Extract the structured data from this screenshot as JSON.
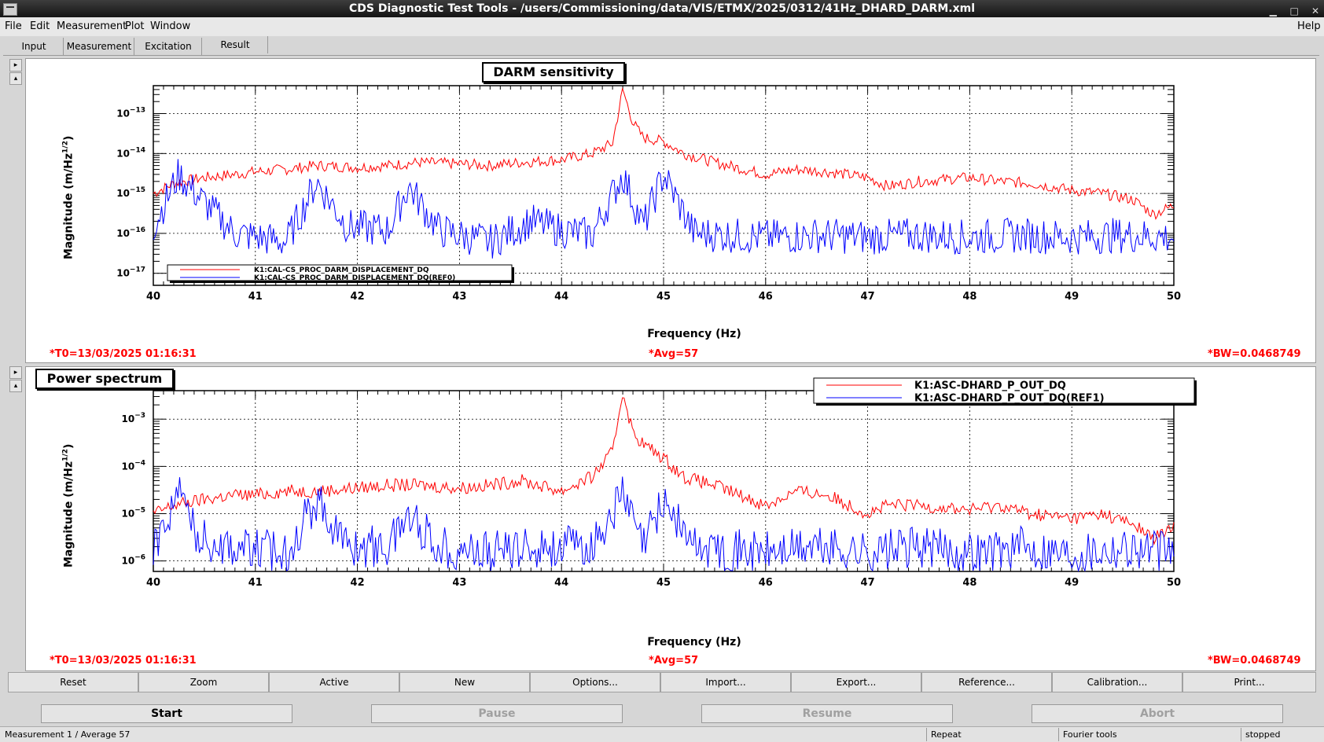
{
  "window": {
    "title": "CDS Diagnostic Test Tools - /users/Commissioning/data/VIS/ETMX/2025/0312/41Hz_DHARD_DARM.xml"
  },
  "menu": [
    "File",
    "Edit",
    "Measurement",
    "Plot",
    "Window"
  ],
  "menu_right": "Help",
  "tabs": [
    "Input",
    "Measurement",
    "Excitation",
    "Result"
  ],
  "active_tab": "Result",
  "plots": [
    {
      "title": "DARM sensitivity",
      "ylabel": "Magnitude (m/Hz",
      "ylabel_sup": "1/2",
      "ylabel_end": ")",
      "xlabel": "Frequency (Hz)",
      "t0": "*T0=13/03/2025 01:16:31",
      "avg": "*Avg=57",
      "bw": "*BW=0.0468749",
      "legend": [
        "K1:CAL-CS_PROC_DARM_DISPLACEMENT_DQ",
        "K1:CAL-CS_PROC_DARM_DISPLACEMENT_DQ(REF0)"
      ]
    },
    {
      "title": "Power spectrum",
      "ylabel": "Magnitude (m/Hz",
      "ylabel_sup": "1/2",
      "ylabel_end": ")",
      "xlabel": "Frequency (Hz)",
      "t0": "*T0=13/03/2025 01:16:31",
      "avg": "*Avg=57",
      "bw": "*BW=0.0468749",
      "legend": [
        "K1:ASC-DHARD_P_OUT_DQ",
        "K1:ASC-DHARD_P_OUT_DQ(REF1)"
      ]
    }
  ],
  "chart_data": [
    {
      "type": "line",
      "title": "DARM sensitivity",
      "xlabel": "Frequency (Hz)",
      "ylabel": "Magnitude (m/Hz^1/2)",
      "xlim": [
        40,
        50
      ],
      "xticks": [
        40,
        41,
        42,
        43,
        44,
        45,
        46,
        47,
        48,
        49,
        50
      ],
      "ylim": [
        5e-18,
        5e-13
      ],
      "yscale": "log",
      "yticks": [
        {
          "v": 1e-13,
          "b": "10",
          "e": "−13"
        },
        {
          "v": 1e-14,
          "b": "10",
          "e": "−14"
        },
        {
          "v": 1e-15,
          "b": "10",
          "e": "−15"
        },
        {
          "v": 1e-16,
          "b": "10",
          "e": "−16"
        },
        {
          "v": 1e-17,
          "b": "10",
          "e": "−17"
        }
      ],
      "grid": true,
      "legend_position": "bottom-left",
      "series": [
        {
          "name": "K1:CAL-CS_PROC_DARM_DISPLACEMENT_DQ",
          "color": "#ff0000",
          "x": [
            40,
            40.2,
            40.5,
            40.8,
            41,
            41.3,
            41.6,
            42,
            42.3,
            42.6,
            43,
            43.3,
            43.6,
            44,
            44.3,
            44.5,
            44.6,
            44.7,
            44.8,
            45,
            45.2,
            45.5,
            46,
            46.3,
            46.6,
            47,
            47.2,
            47.5,
            48,
            48.3,
            48.6,
            49,
            49.3,
            49.6,
            49.8,
            50
          ],
          "y": [
            1e-15,
            1.8e-15,
            2.5e-15,
            3e-15,
            3.5e-15,
            4e-15,
            5e-15,
            4.5e-15,
            5e-15,
            6e-15,
            5.5e-15,
            5e-15,
            6e-15,
            7e-15,
            1e-14,
            1.8e-14,
            4e-13,
            6e-14,
            2.5e-14,
            2e-14,
            1e-14,
            6e-15,
            3e-15,
            4e-15,
            3.5e-15,
            2.5e-15,
            1.5e-15,
            2e-15,
            2.5e-15,
            2e-15,
            1.8e-15,
            1.2e-15,
            1e-15,
            7e-16,
            3e-16,
            5e-16
          ]
        },
        {
          "name": "K1:CAL-CS_PROC_DARM_DISPLACEMENT_DQ(REF0)",
          "color": "#0000ff",
          "x": [
            40,
            40.25,
            40.45,
            40.8,
            41.3,
            41.6,
            41.9,
            42.3,
            42.5,
            42.8,
            43.3,
            43.7,
            44,
            44.3,
            44.6,
            44.8,
            45,
            45.3,
            46,
            46.5,
            47,
            47.5,
            48,
            48.5,
            49,
            49.5,
            50
          ],
          "y": [
            1.5e-16,
            3e-15,
            8e-16,
            1e-16,
            6e-17,
            2e-15,
            1.5e-16,
            1.2e-16,
            1.5e-15,
            1.2e-16,
            6e-17,
            2e-16,
            1.2e-16,
            9e-17,
            3e-15,
            1.5e-16,
            3e-15,
            1e-16,
            8e-17,
            9e-17,
            8e-17,
            9e-17,
            8e-17,
            9e-17,
            8e-17,
            9e-17,
            8e-17
          ]
        }
      ]
    },
    {
      "type": "line",
      "title": "Power spectrum",
      "xlabel": "Frequency (Hz)",
      "ylabel": "Magnitude (m/Hz^1/2)",
      "xlim": [
        40,
        50
      ],
      "xticks": [
        40,
        41,
        42,
        43,
        44,
        45,
        46,
        47,
        48,
        49,
        50
      ],
      "ylim": [
        6e-07,
        0.004
      ],
      "yscale": "log",
      "yticks": [
        {
          "v": 0.001,
          "b": "10",
          "e": "−3"
        },
        {
          "v": 0.0001,
          "b": "10",
          "e": "−4"
        },
        {
          "v": 1e-05,
          "b": "10",
          "e": "−5"
        },
        {
          "v": 1e-06,
          "b": "10",
          "e": "−6"
        }
      ],
      "grid": true,
      "legend_position": "top-right",
      "series": [
        {
          "name": "K1:ASC-DHARD_P_OUT_DQ",
          "color": "#ff0000",
          "x": [
            40,
            40.2,
            40.5,
            40.8,
            41,
            41.3,
            41.6,
            42,
            42.3,
            42.6,
            43,
            43.3,
            43.6,
            44,
            44.3,
            44.5,
            44.6,
            44.7,
            44.8,
            45,
            45.2,
            45.5,
            46,
            46.3,
            46.6,
            47,
            47.2,
            47.5,
            48,
            48.3,
            48.6,
            49,
            49.3,
            49.6,
            49.8,
            50
          ],
          "y": [
            1e-05,
            1.5e-05,
            2e-05,
            2.5e-05,
            2.5e-05,
            3e-05,
            3e-05,
            3.5e-05,
            4e-05,
            4e-05,
            3.5e-05,
            4e-05,
            5e-05,
            3e-05,
            6e-05,
            0.0002,
            0.004,
            0.0005,
            0.0003,
            0.00015,
            6e-05,
            4e-05,
            1.5e-05,
            3e-05,
            2.5e-05,
            1e-05,
            1.5e-05,
            1.5e-05,
            1.2e-05,
            1.5e-05,
            1e-05,
            8e-06,
            1e-05,
            6e-06,
            3e-06,
            5e-06
          ]
        },
        {
          "name": "K1:ASC-DHARD_P_OUT_DQ(REF1)",
          "color": "#0000ff",
          "x": [
            40,
            40.25,
            40.45,
            40.8,
            41.3,
            41.6,
            41.9,
            42.3,
            42.5,
            42.8,
            43.3,
            43.7,
            44,
            44.3,
            44.6,
            44.8,
            45,
            45.3,
            46,
            46.5,
            47,
            47.5,
            48,
            48.5,
            49,
            49.5,
            50
          ],
          "y": [
            2e-06,
            3e-05,
            3e-06,
            2e-06,
            1.5e-06,
            2e-05,
            2e-06,
            2e-06,
            1e-05,
            2e-06,
            1.5e-06,
            2e-06,
            2e-06,
            2e-06,
            2.5e-05,
            2e-06,
            2e-05,
            2e-06,
            1.5e-06,
            2e-06,
            1.5e-06,
            2e-06,
            1.5e-06,
            2e-06,
            1.5e-06,
            2e-06,
            1.5e-06
          ]
        }
      ]
    }
  ],
  "func_buttons": [
    "Reset",
    "Zoom",
    "Active",
    "New",
    "Options...",
    "Import...",
    "Export...",
    "Reference...",
    "Calibration...",
    "Print..."
  ],
  "controls": {
    "start": "Start",
    "pause": "Pause",
    "resume": "Resume",
    "abort": "Abort"
  },
  "status": {
    "left": "Measurement 1 / Average 57",
    "repeat": "Repeat",
    "tools": "Fourier tools",
    "state": "stopped"
  },
  "colors": {
    "red": "#ff0000",
    "blue": "#0000ff",
    "info": "#ff0000"
  }
}
